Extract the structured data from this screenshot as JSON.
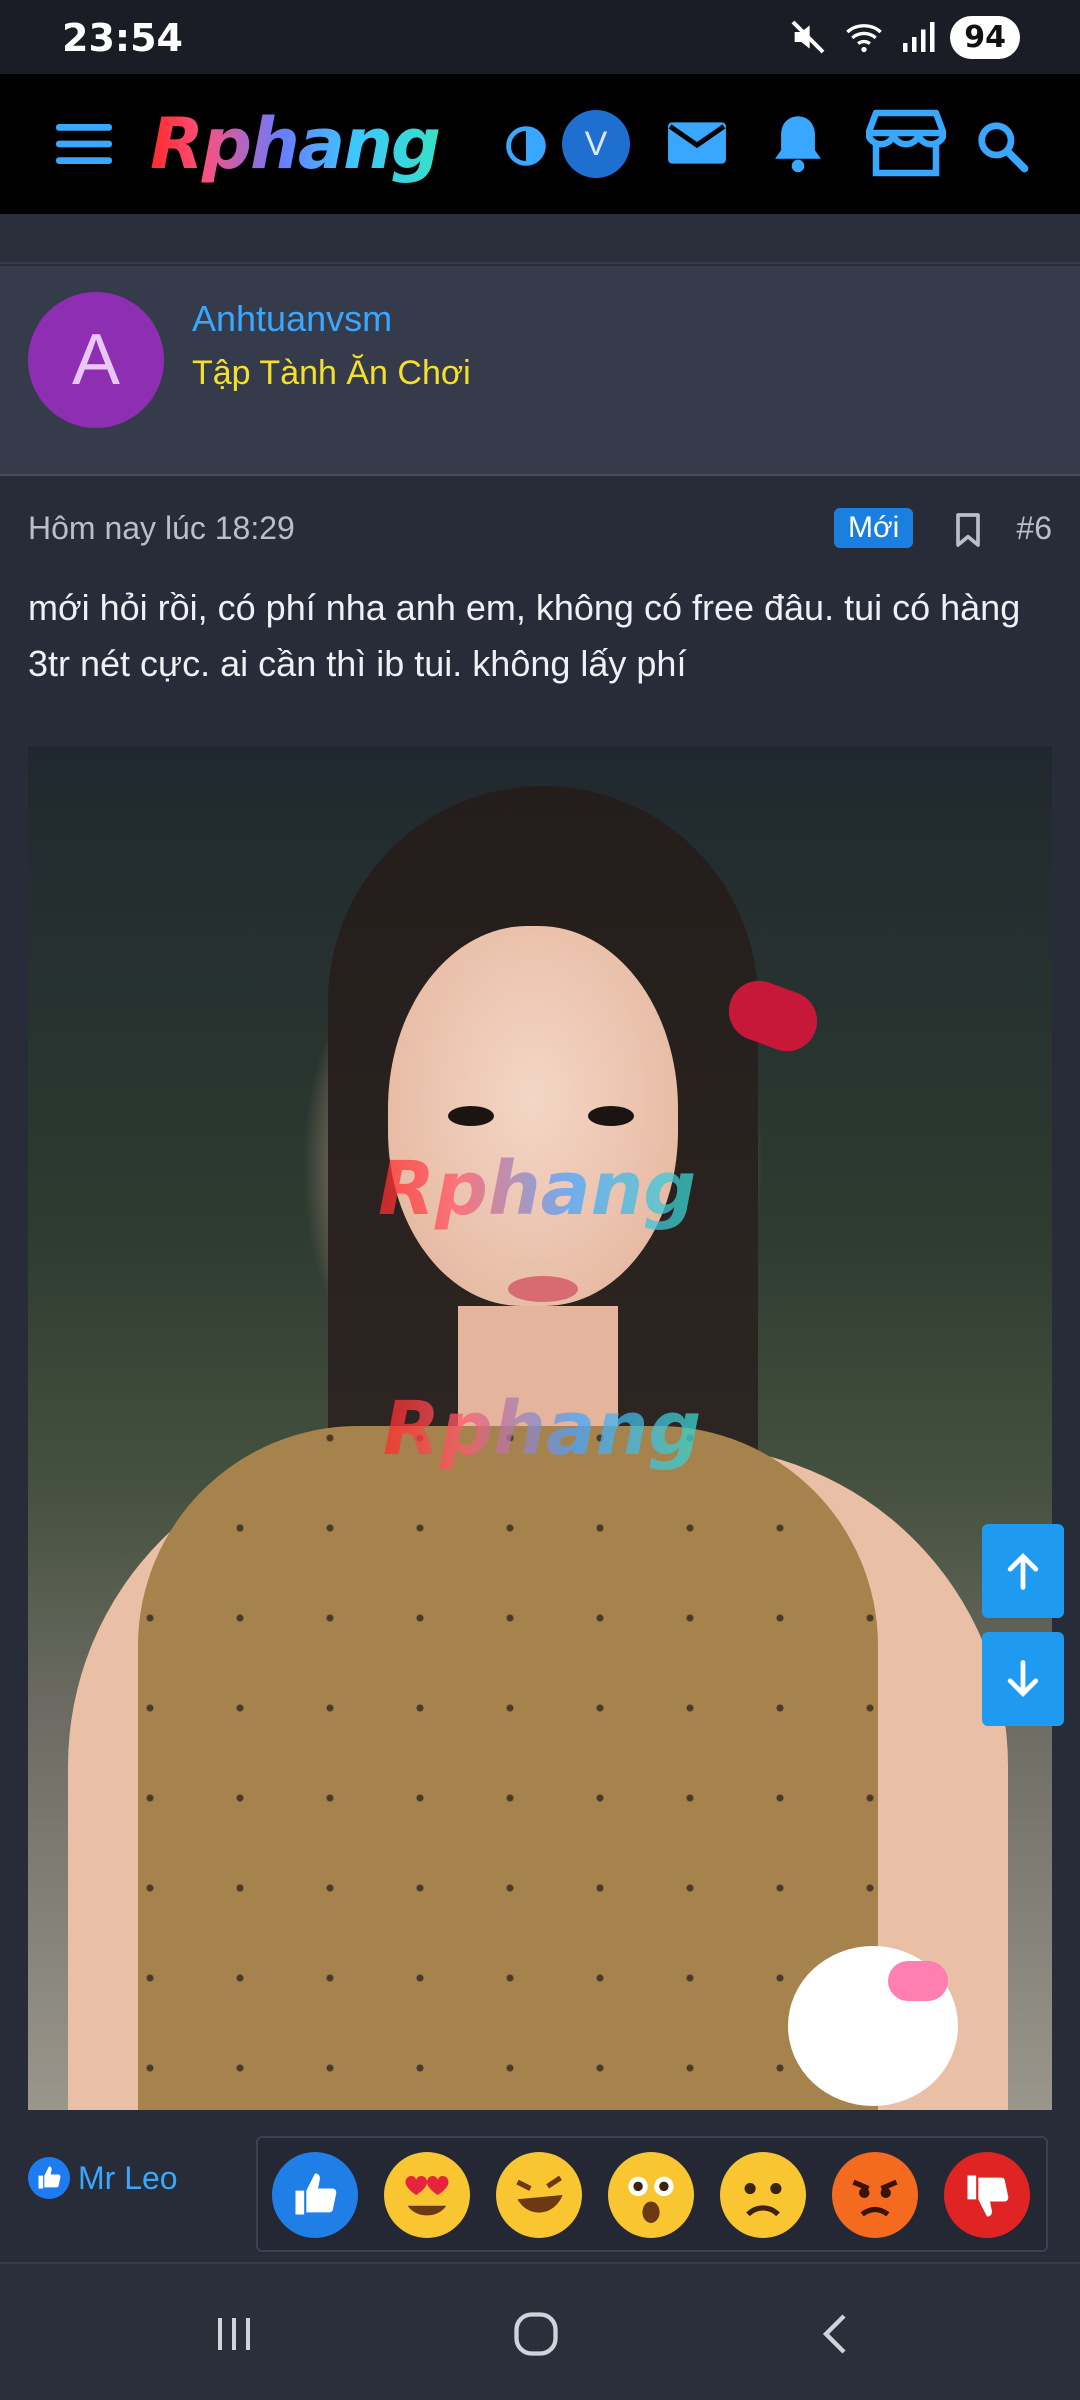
{
  "status": {
    "time": "23:54",
    "battery": "94"
  },
  "header": {
    "logo_text": "Rphang",
    "user_initial": "V"
  },
  "author": {
    "initial": "A",
    "name": "Anhtuanvsm",
    "title": "Tập Tành Ăn Chơi"
  },
  "post": {
    "date": "Hôm nay lúc 18:29",
    "badge": "Mới",
    "number": "#6",
    "text": "mới hỏi rồi, có phí nha anh em, không có free đâu. tui có hàng 3tr nét cực. ai cần thì ib tui. không lấy phí"
  },
  "image": {
    "watermark": "Rphang"
  },
  "reactions": {
    "liked_by": "Mr Leo",
    "items": [
      "like",
      "love",
      "haha",
      "wow",
      "sad",
      "angry",
      "dislike"
    ]
  },
  "colors": {
    "accent": "#3aa7ff",
    "role": "#f4e02a",
    "badge": "#1b7fe0",
    "scroll": "#1e9bf0"
  }
}
